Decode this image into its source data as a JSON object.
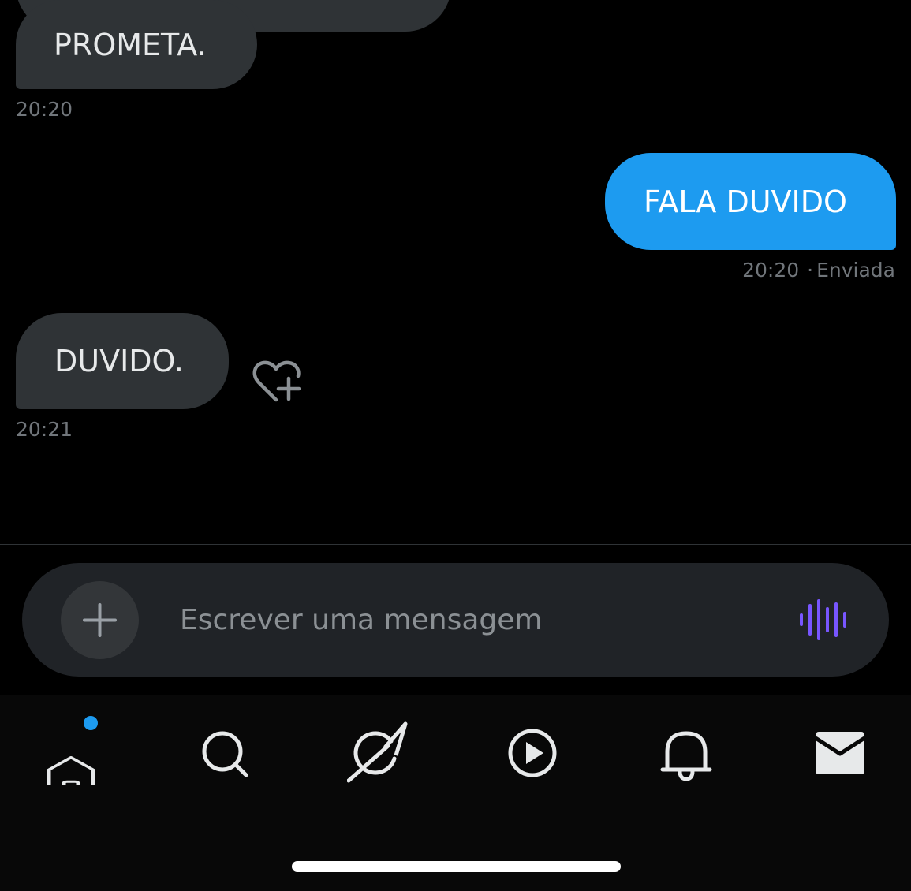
{
  "messages": [
    {
      "direction": "received",
      "text": "PROMETA.",
      "time": "20:20"
    },
    {
      "direction": "sent",
      "text": "FALA DUVIDO",
      "time": "20:20",
      "status": "Enviada"
    },
    {
      "direction": "received",
      "text": "DUVIDO.",
      "time": "20:21"
    }
  ],
  "separator": "·",
  "composer": {
    "placeholder": "Escrever uma mensagem",
    "add_icon": "plus-icon",
    "voice_icon": "voice-waveform-icon"
  },
  "nav": {
    "items": [
      {
        "name": "home",
        "icon": "home-icon",
        "has_notification": true
      },
      {
        "name": "search",
        "icon": "search-icon"
      },
      {
        "name": "grok",
        "icon": "grok-icon"
      },
      {
        "name": "video",
        "icon": "play-icon"
      },
      {
        "name": "notifications",
        "icon": "bell-icon"
      },
      {
        "name": "messages",
        "icon": "mail-icon",
        "active": true
      }
    ]
  },
  "colors": {
    "background": "#000000",
    "received_bubble": "#2f3336",
    "sent_bubble": "#1d9bf0",
    "timestamp": "#71767b",
    "voice_accent": "#7856ff",
    "notification_dot": "#1d9bf0"
  }
}
